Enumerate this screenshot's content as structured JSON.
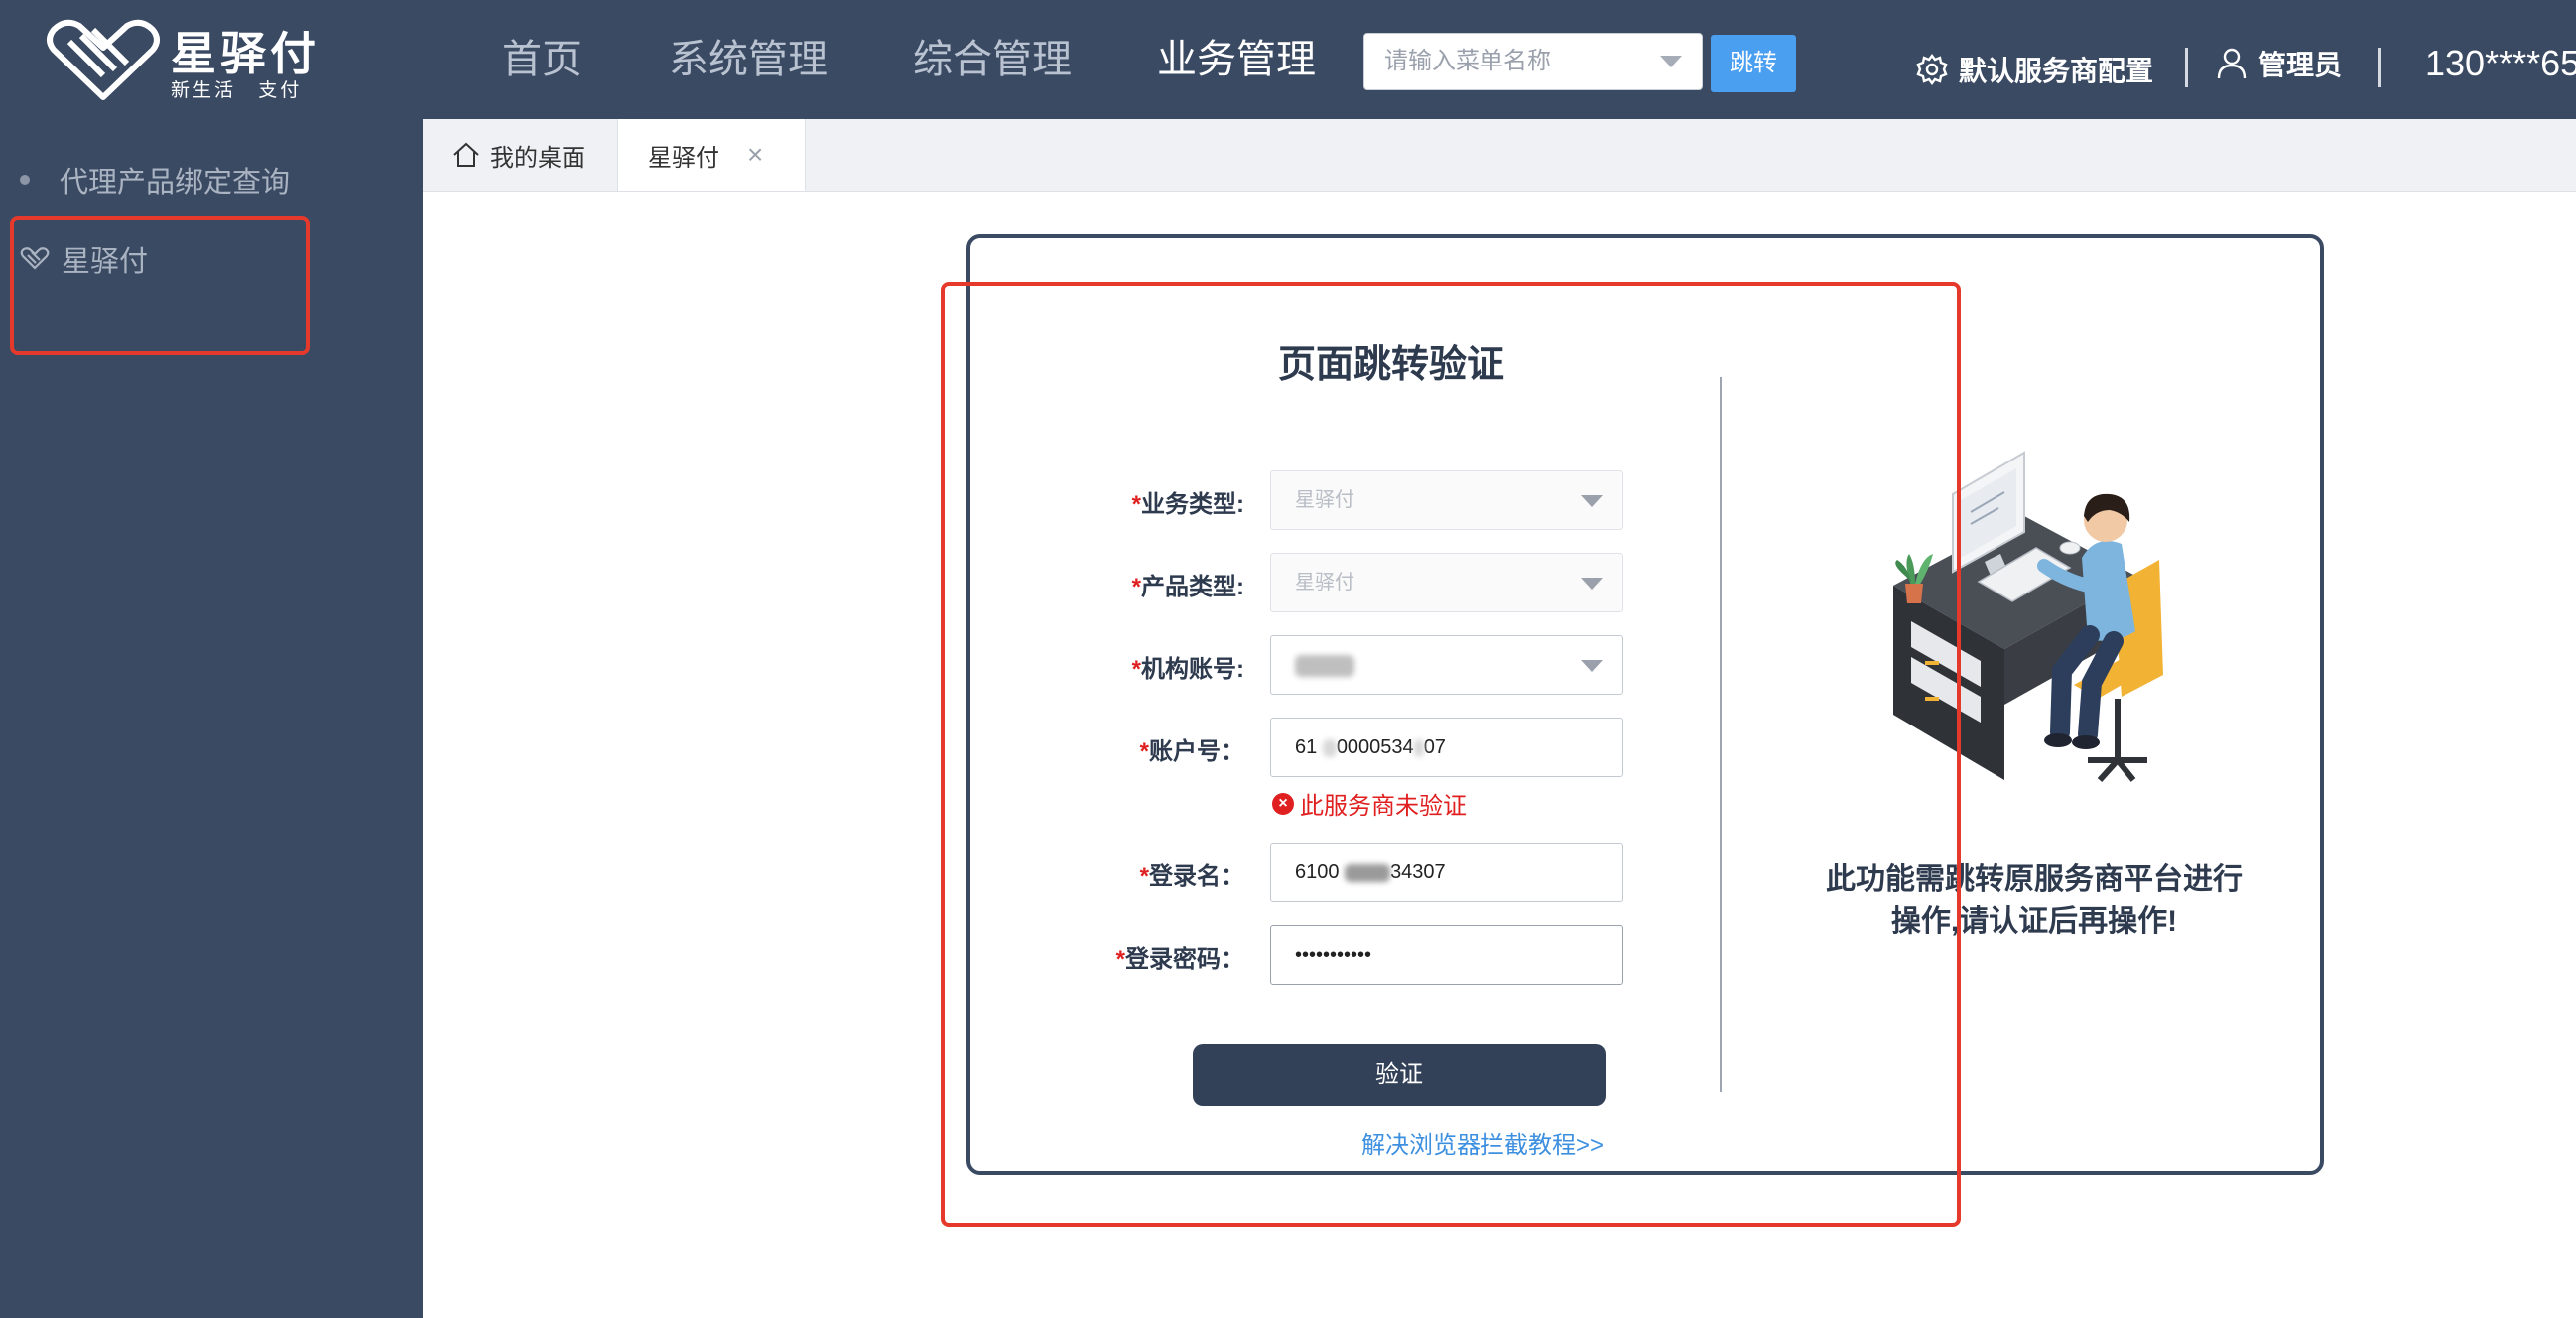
{
  "brand": {
    "name": "星驿付",
    "slogan_left": "新生活",
    "slogan_right": "支付"
  },
  "nav": {
    "items": [
      {
        "label": "首页"
      },
      {
        "label": "系统管理"
      },
      {
        "label": "综合管理"
      },
      {
        "label": "业务管理"
      }
    ],
    "active": "业务管理",
    "menu_search_placeholder": "请输入菜单名称",
    "jump_label": "跳转",
    "provider_config": "默认服务商配置",
    "user": "管理员",
    "phone": "130****65"
  },
  "sidebar": {
    "items": [
      {
        "label": "代理产品绑定查询",
        "icon": "dot-icon"
      },
      {
        "label": "星驿付",
        "icon": "heart-logo-icon"
      }
    ]
  },
  "tabs": [
    {
      "label": "我的桌面",
      "icon": "home-icon"
    },
    {
      "label": "星驿付",
      "closable": true
    }
  ],
  "verify_form": {
    "title": "页面跳转验证",
    "fields": [
      {
        "label": "业务类型:",
        "required": true,
        "value": "星驿付",
        "type": "select",
        "disabled": true
      },
      {
        "label": "产品类型:",
        "required": true,
        "value": "星驿付",
        "type": "select",
        "disabled": true
      },
      {
        "label": "机构账号:",
        "required": true,
        "value": "",
        "type": "select"
      },
      {
        "label": "账户号：",
        "required": true,
        "value_start": "61",
        "value_mid": "0000534",
        "value_end": "07",
        "type": "text"
      },
      {
        "label": "登录名：",
        "required": true,
        "value_start": "6100",
        "value_end": "34307",
        "type": "text"
      },
      {
        "label": "登录密码：",
        "required": true,
        "value": "•••••••••••",
        "type": "password"
      }
    ],
    "error": "此服务商未验证",
    "submit_label": "验证",
    "help_link": "解决浏览器拦截教程>>"
  },
  "notice": {
    "line1": "此功能需跳转原服务商平台进行",
    "line2": "操作,请认证后再操作!"
  },
  "colors": {
    "header_bg": "#3b4a63",
    "accent_blue": "#4a9ff0",
    "error_red": "#e02020",
    "button_dark": "#334158"
  }
}
